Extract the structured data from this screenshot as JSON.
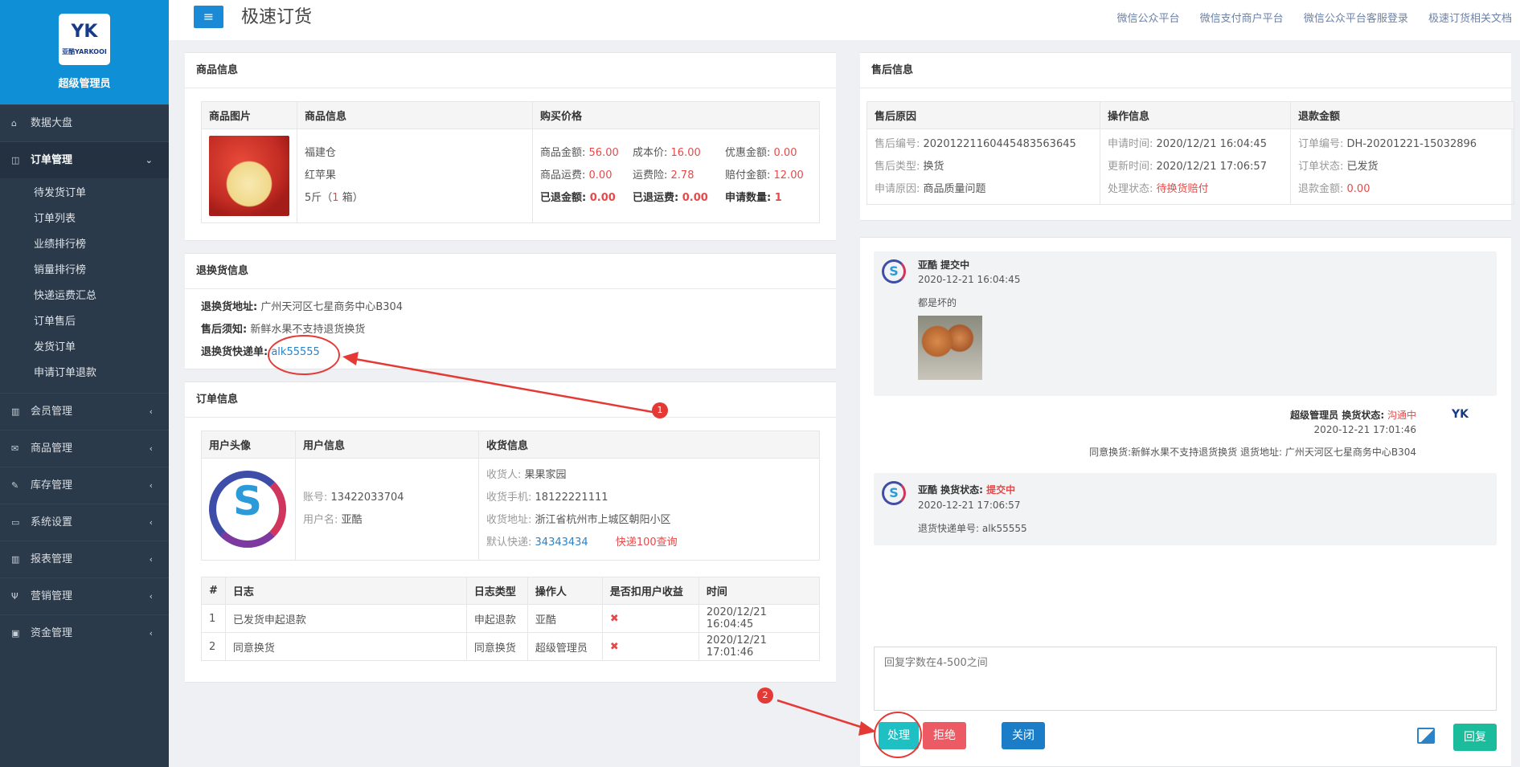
{
  "sidebar": {
    "logo": {
      "mark": "YK",
      "sub": "亚酷YARKOOI"
    },
    "brand_title": "超级管理员",
    "menu": [
      {
        "label": "数据大盘",
        "icon": "home-icon"
      },
      {
        "label": "订单管理",
        "icon": "columns-icon"
      },
      {
        "label": "会员管理",
        "icon": "bar-chart-icon"
      },
      {
        "label": "商品管理",
        "icon": "envelope-icon"
      },
      {
        "label": "库存管理",
        "icon": "edit-icon"
      },
      {
        "label": "系统设置",
        "icon": "desktop-icon"
      },
      {
        "label": "报表管理",
        "icon": "bar-chart-icon"
      },
      {
        "label": "营销管理",
        "icon": "cutlery-icon"
      },
      {
        "label": "资金管理",
        "icon": "money-icon"
      }
    ],
    "order_submenu": [
      "待发货订单",
      "订单列表",
      "业绩排行榜",
      "销量排行榜",
      "快递运费汇总",
      "订单售后",
      "发货订单",
      "申请订单退款"
    ]
  },
  "header": {
    "title": "极速订货",
    "links": [
      "微信公众平台",
      "微信支付商户平台",
      "微信公众平台客服登录",
      "极速订货相关文档"
    ]
  },
  "product_panel": {
    "title": "商品信息",
    "headers": [
      "商品图片",
      "商品信息",
      "购买价格"
    ],
    "info": [
      "福建仓",
      "红苹果",
      "5斤",
      "1",
      "箱"
    ],
    "prices": [
      [
        {
          "k": "商品金额:",
          "v": "56.00"
        },
        {
          "k": "成本价:",
          "v": "16.00"
        },
        {
          "k": "优惠金额:",
          "v": "0.00"
        }
      ],
      [
        {
          "k": "商品运费:",
          "v": "0.00"
        },
        {
          "k": "运费险:",
          "v": "2.78"
        },
        {
          "k": "赔付金额:",
          "v": "12.00"
        }
      ],
      [
        {
          "k": "已退金额:",
          "v": "0.00"
        },
        {
          "k": "已退运费:",
          "v": "0.00"
        },
        {
          "k": "申请数量:",
          "v": "1"
        }
      ]
    ]
  },
  "return_panel": {
    "title": "退换货信息",
    "address_label": "退换货地址:",
    "address": "广州天河区七星商务中心B304",
    "notice_label": "售后须知:",
    "notice": "新鲜水果不支持退货换货",
    "tracking_label": "退换货快递单:",
    "tracking": "alk55555"
  },
  "order_panel": {
    "title": "订单信息",
    "headers": [
      "用户头像",
      "用户信息",
      "收货信息"
    ],
    "account_label": "账号:",
    "account": "13422033704",
    "username_label": "用户名:",
    "username": "亚酷",
    "receiver_label": "收货人:",
    "receiver": "果果家园",
    "phone_label": "收货手机:",
    "phone": "18122221111",
    "address_label": "收货地址:",
    "address": "浙江省杭州市上城区朝阳小区",
    "express_label": "默认快递:",
    "express": "34343434",
    "express_query": "快递100查询"
  },
  "log_table": {
    "headers": [
      "#",
      "日志",
      "日志类型",
      "操作人",
      "是否扣用户收益",
      "时间"
    ],
    "rows": [
      {
        "idx": "1",
        "log": "已发货申起退款",
        "type": "申起退款",
        "operator": "亚酷",
        "deduct": "✖",
        "time": "2020/12/21 16:04:45"
      },
      {
        "idx": "2",
        "log": "同意换货",
        "type": "同意换货",
        "operator": "超级管理员",
        "deduct": "✖",
        "time": "2020/12/21 17:01:46"
      }
    ]
  },
  "aftersale_panel": {
    "title": "售后信息",
    "headers": [
      "售后原因",
      "操作信息",
      "退款金额"
    ],
    "col1": [
      {
        "k": "售后编号:",
        "v": "20201221160445483563645"
      },
      {
        "k": "售后类型:",
        "v": "换货"
      },
      {
        "k": "申请原因:",
        "v": "商品质量问题"
      }
    ],
    "col2": [
      {
        "k": "申请时间:",
        "v": "2020/12/21 16:04:45"
      },
      {
        "k": "更新时间:",
        "v": "2020/12/21 17:06:57"
      },
      {
        "k": "处理状态:",
        "v": "待换货赔付"
      }
    ],
    "col3": [
      {
        "k": "订单编号:",
        "v": "DH-20201221-15032896"
      },
      {
        "k": "订单状态:",
        "v": "已发货"
      },
      {
        "k": "退款金额:",
        "v": "0.00"
      }
    ]
  },
  "chat": {
    "messages": [
      {
        "name": "亚酷 提交中",
        "time": "2020-12-21 16:04:45",
        "text": "都是坏的"
      },
      {
        "name": "超级管理员 换货状态:",
        "status": "沟通中",
        "time": "2020-12-21 17:01:46",
        "text": "同意换货:新鲜水果不支持退货换货 退货地址: 广州天河区七星商务中心B304"
      },
      {
        "name": "亚酷 换货状态:",
        "status": "提交中",
        "time": "2020-12-21 17:06:57",
        "text": "退货快递单号: alk55555"
      }
    ],
    "reply_placeholder": "回复字数在4-500之间",
    "buttons": {
      "process": "处理",
      "reject": "拒绝",
      "close": "关闭",
      "reply": "回复"
    }
  },
  "annotations": [
    "1",
    "2"
  ],
  "colors": {
    "primary": "#1b8ad6",
    "red": "#e54a4a",
    "teal": "#1fc0c3",
    "green": "#1abc9c",
    "sidebar": "#2b3a4a"
  }
}
